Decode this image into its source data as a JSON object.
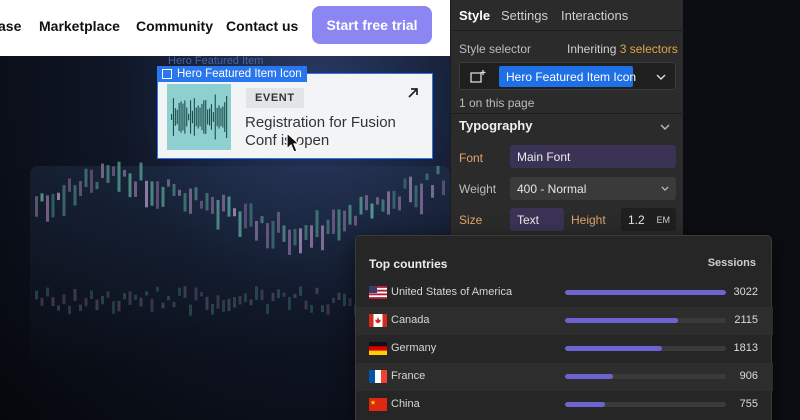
{
  "site": {
    "nav": {
      "links": [
        "ase",
        "Marketplace",
        "Community",
        "Contact us"
      ],
      "cta": "Start free trial"
    },
    "selection": {
      "ghost_label": "Hero Featured Item",
      "label": "Hero Featured Item Icon"
    },
    "card": {
      "badge": "EVENT",
      "title": "Registration for Fusion Conf is open"
    }
  },
  "panel": {
    "tabs": [
      "Style",
      "Settings",
      "Interactions"
    ],
    "style_selector_label": "Style selector",
    "inheriting": {
      "prefix": "Inheriting",
      "count": "3 selectors"
    },
    "selector_chip": "Hero Featured Item Icon",
    "on_page": "1 on this page",
    "typography": {
      "title": "Typography",
      "font_label": "Font",
      "font_value": "Main Font",
      "weight_label": "Weight",
      "weight_value": "400 - Normal",
      "size_label": "Size",
      "size_value": "Text",
      "height_label": "Height",
      "height_value": "1.2",
      "height_unit": "EM"
    }
  },
  "stats": {
    "title": "Top countries",
    "column": "Sessions",
    "max": 3022,
    "rows": [
      {
        "country": "United States of America",
        "flag": "us-flag-icon",
        "value": 3022
      },
      {
        "country": "Canada",
        "flag": "canada-flag-icon",
        "value": 2115
      },
      {
        "country": "Germany",
        "flag": "germany-flag-icon",
        "value": 1813
      },
      {
        "country": "France",
        "flag": "france-flag-icon",
        "value": 906
      },
      {
        "country": "China",
        "flag": "china-flag-icon",
        "value": 755
      }
    ]
  },
  "colors": {
    "cta": "#8b86f2",
    "selection_blue": "#2a76ee",
    "panel_bg": "#2b2b2b",
    "accent_orange": "#e0a46f",
    "bar": "#6e64cf"
  }
}
